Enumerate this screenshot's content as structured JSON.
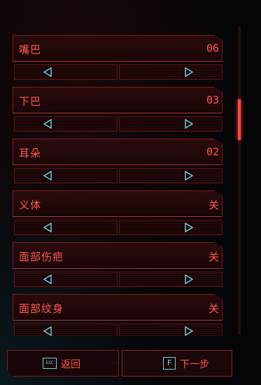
{
  "options": [
    {
      "label": "嘴巴",
      "value": "06"
    },
    {
      "label": "下巴",
      "value": "03"
    },
    {
      "label": "耳朵",
      "value": "02"
    },
    {
      "label": "义体",
      "value": "关"
    },
    {
      "label": "面部伤疤",
      "value": "关"
    },
    {
      "label": "面部纹身",
      "value": "关"
    }
  ],
  "footer": {
    "back_key": "ESC",
    "back_label": "返回",
    "next_key": "F",
    "next_label": "下一步"
  },
  "colors": {
    "accent": "#ff5a52",
    "arrow": "#6fd4dc",
    "border": "#7a1d1e"
  },
  "icons": {
    "left": "triangle-left-icon",
    "right": "triangle-right-icon"
  }
}
